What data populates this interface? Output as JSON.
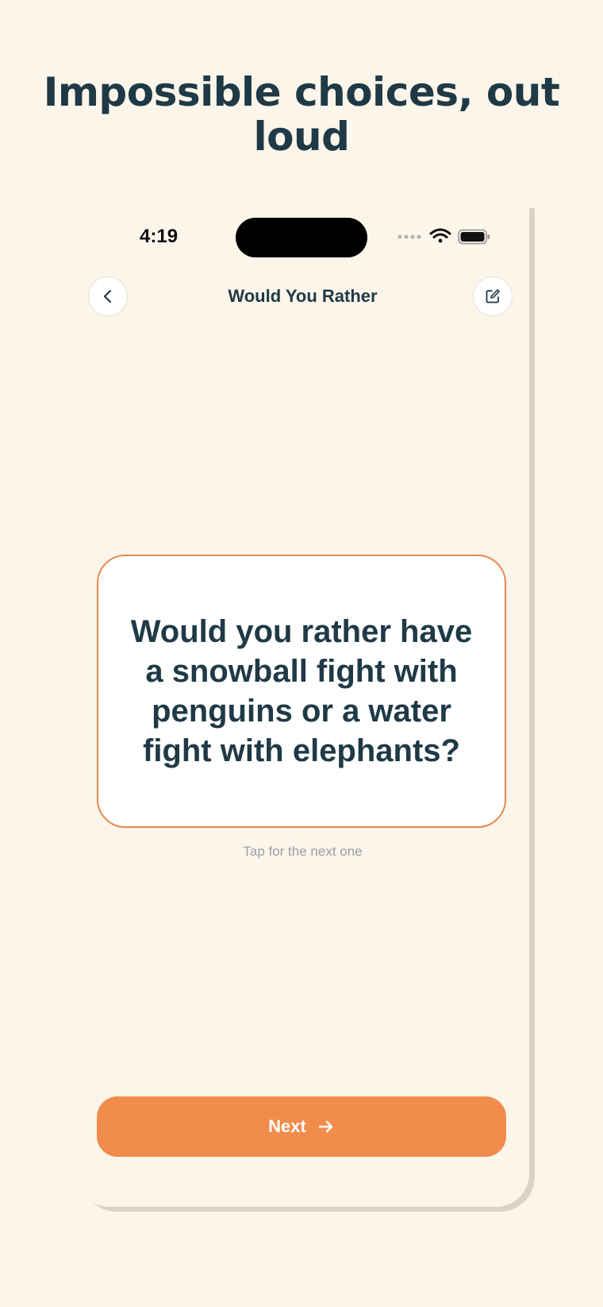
{
  "headline": "Impossible choices, out loud",
  "status_bar": {
    "time": "4:19"
  },
  "nav": {
    "title": "Would You Rather",
    "back_icon": "chevron-left-icon",
    "edit_icon": "edit-square-icon"
  },
  "card": {
    "question": "Would you rather have a snowball fight with penguins or a water fight with elephants?"
  },
  "hint": "Tap for the next one",
  "next_button": {
    "label": "Next",
    "icon": "arrow-right-icon"
  },
  "colors": {
    "background": "#fcf5ea",
    "text": "#1f3a46",
    "accent": "#f08c4c",
    "card_border": "#e48a4e"
  }
}
